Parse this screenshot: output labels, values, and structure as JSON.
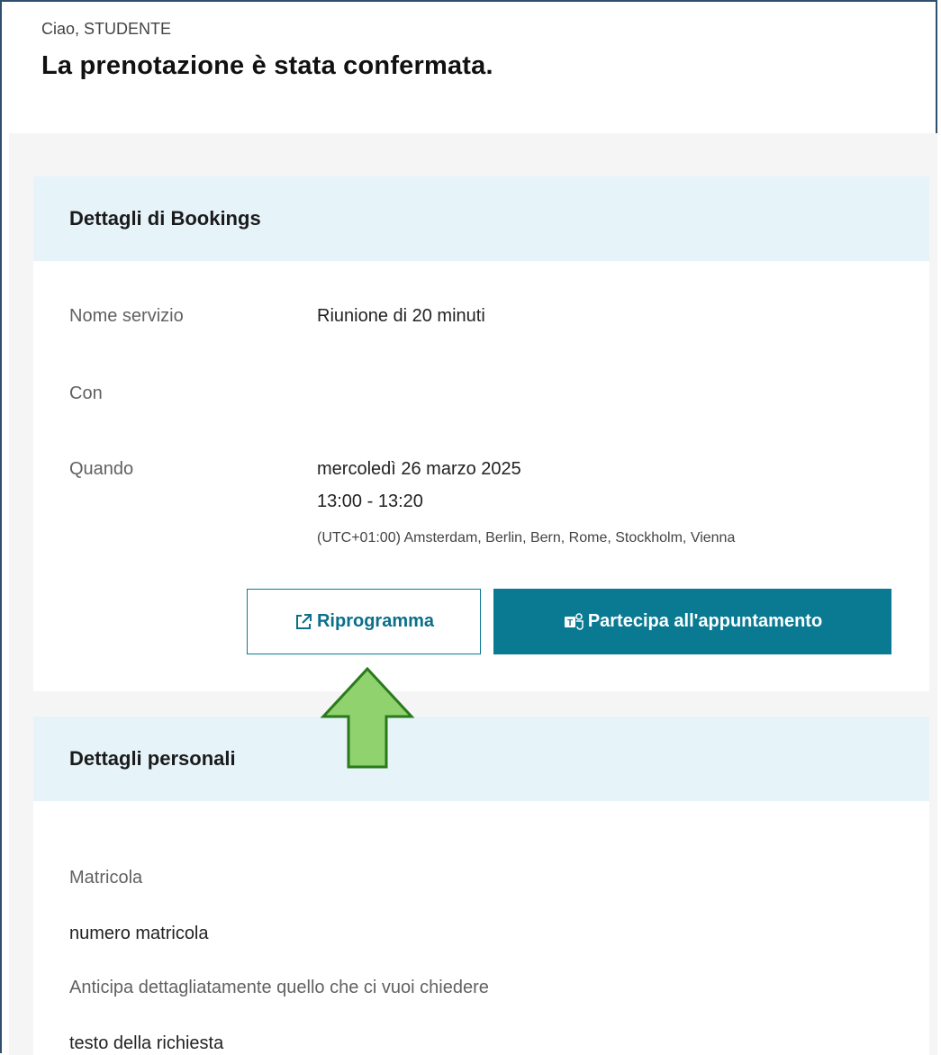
{
  "header": {
    "greeting": "Ciao, STUDENTE",
    "title": "La prenotazione è stata confermata."
  },
  "bookings": {
    "heading": "Dettagli di Bookings",
    "service_label": "Nome servizio",
    "service_value": "Riunione di 20 minuti",
    "with_label": "Con",
    "when_label": "Quando",
    "date": "mercoledì 26 marzo 2025",
    "time": "13:00 - 13:20",
    "timezone": "(UTC+01:00) Amsterdam, Berlin, Bern, Rome, Stockholm, Vienna",
    "reschedule_label": "Riprogramma",
    "join_label": "Partecipa all'appuntamento"
  },
  "personal": {
    "heading": "Dettagli personali",
    "matricola_label": "Matricola",
    "matricola_value": "numero matricola",
    "question_label": "Anticipa dettagliatamente quello che ci vuoi chiedere",
    "question_value": "testo della richiesta"
  },
  "colors": {
    "accent": "#0a7a93",
    "section_header_bg": "#e6f4fa",
    "arrow_fill": "#8fd26e",
    "arrow_stroke": "#2a7a1c"
  },
  "icons": {
    "reschedule": "open-external-icon",
    "join": "teams-icon",
    "annotation": "up-arrow-icon"
  }
}
